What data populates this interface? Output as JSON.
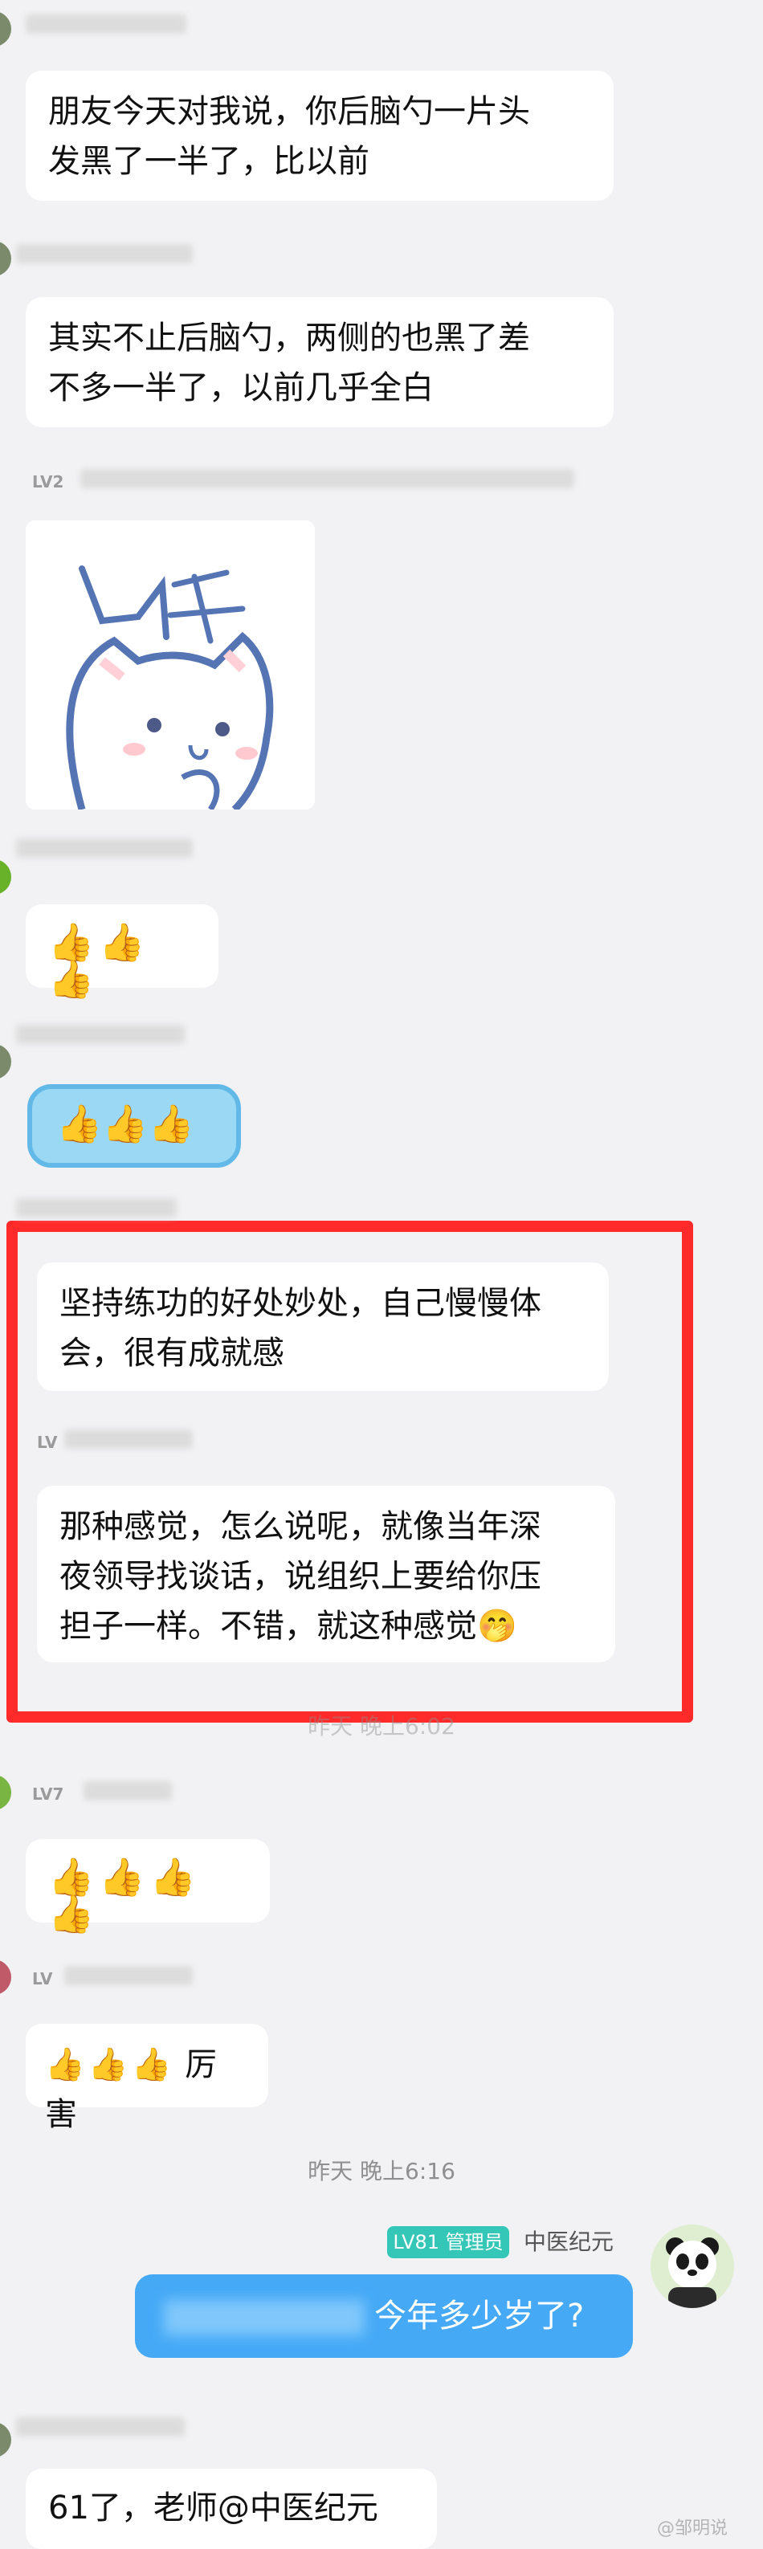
{
  "messages": [
    {
      "lv": "",
      "text_line1": "朋友今天对我说，你后脑勺一片头",
      "text_line2": "发黑了一半了，比以前"
    },
    {
      "lv": "",
      "text_line1": "其实不止后脑勺，两侧的也黑了差",
      "text_line2": "不多一半了，以前几乎全白"
    },
    {
      "lv": "LV2",
      "sticker_text": "厉害"
    },
    {
      "lv": "",
      "thumbs": "👍👍👍"
    },
    {
      "lv": "",
      "thumbs": "👍👍👍"
    },
    {
      "lv": "",
      "text_line1": "坚持练功的好处妙处，自己慢慢体",
      "text_line2": "会，很有成就感"
    },
    {
      "lv": "LV",
      "text_line1": "那种感觉，怎么说呢，就像当年深",
      "text_line2": "夜领导找谈话，说组织上要给你压",
      "text_line3": "担子一样。不错，就这种感觉🤭"
    },
    {
      "lv": "LV7",
      "thumbs": "👍👍👍👍"
    },
    {
      "lv": "LV",
      "thumbs": "👍👍👍",
      "suffix": " 厉害"
    },
    {
      "lv": "",
      "text_line1": "61了，老师@中医纪元"
    }
  ],
  "timestamps": {
    "t1": "昨天 晚上6:02",
    "t2": "昨天 晚上6:16"
  },
  "admin": {
    "badge": "LV81 管理员",
    "name": "中医纪元",
    "message": "今年多少岁了?"
  },
  "watermark": "@邹明说",
  "colors": {
    "background": "#f2f2f4",
    "highlight_box": "#ff2a2a",
    "self_bubble": "#45a9f6",
    "admin_badge": "#34c6b6"
  }
}
